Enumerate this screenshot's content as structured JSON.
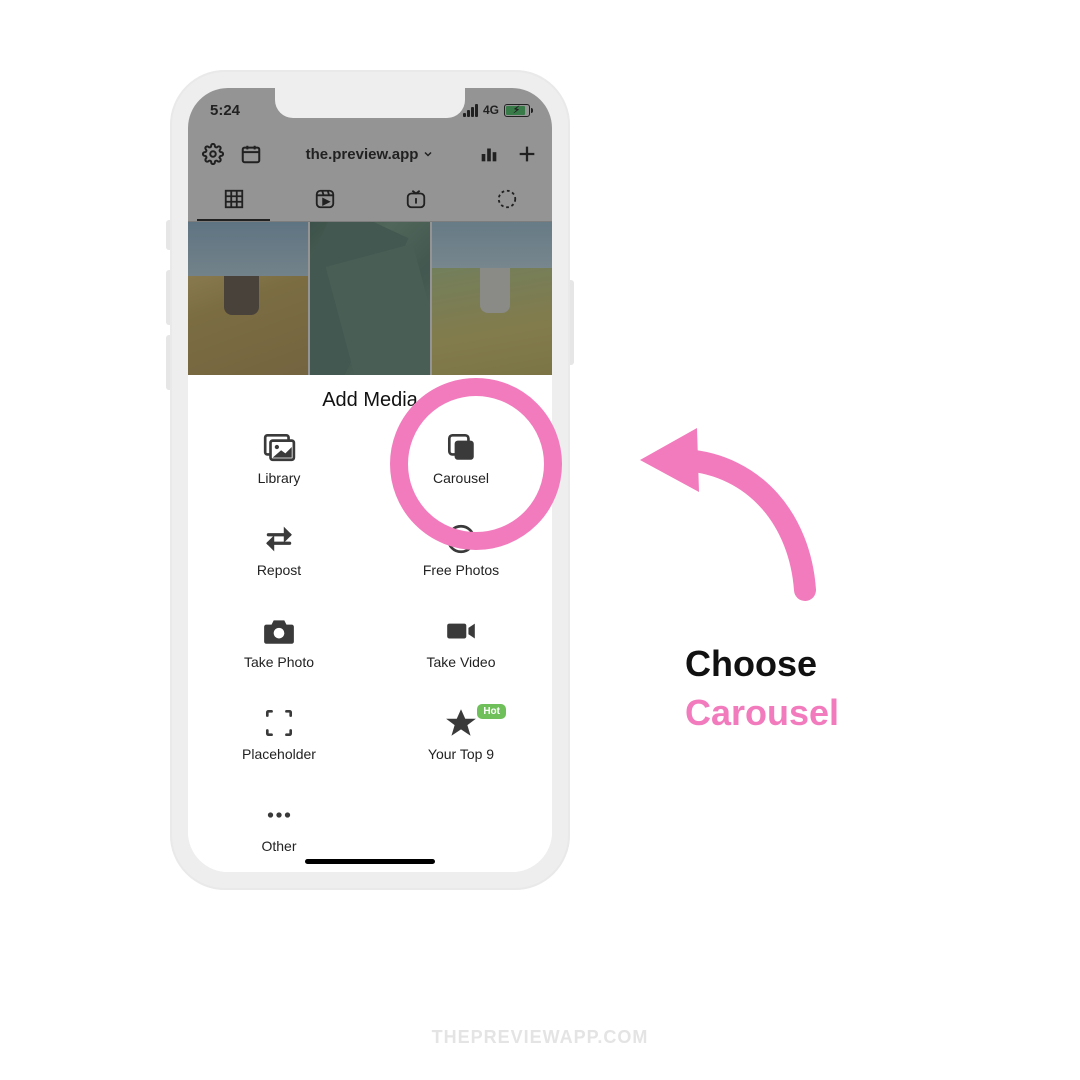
{
  "status": {
    "time": "5:24",
    "network": "4G"
  },
  "toolbar": {
    "account": "the.preview.app"
  },
  "sheet": {
    "title": "Add Media",
    "options": {
      "library": "Library",
      "carousel": "Carousel",
      "repost": "Repost",
      "free_photos": "Free Photos",
      "take_photo": "Take Photo",
      "take_video": "Take Video",
      "placeholder": "Placeholder",
      "your_top_9": "Your Top 9",
      "other": "Other"
    },
    "hot_badge": "Hot"
  },
  "annotation": {
    "line1": "Choose",
    "line2": "Carousel"
  },
  "watermark": "THEPREVIEWAPP.COM"
}
